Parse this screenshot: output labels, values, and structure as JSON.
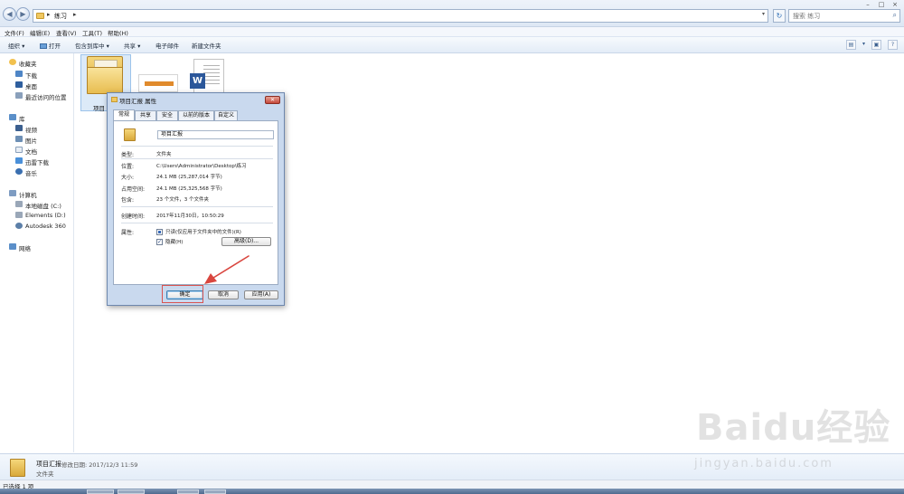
{
  "address": {
    "path": "练习",
    "search_placeholder": "搜索 练习"
  },
  "menu": [
    "文件(F)",
    "编辑(E)",
    "查看(V)",
    "工具(T)",
    "帮助(H)"
  ],
  "toolbar": {
    "organize": "组织 ▾",
    "open": "打开",
    "include": "包含到库中 ▾",
    "share": "共享 ▾",
    "email": "电子邮件",
    "new_folder": "新建文件夹"
  },
  "nav": {
    "favorites": "收藏夹",
    "downloads": "下载",
    "desktop": "桌面",
    "recent": "最近访问的位置",
    "libraries": "库",
    "videos": "视频",
    "pictures": "图片",
    "documents": "文档",
    "thunder": "迅雷下载",
    "music": "音乐",
    "computer": "计算机",
    "local_disk": "本地磁盘 (C:)",
    "elements": "Elements (D:)",
    "autodesk": "Autodesk 360",
    "network": "网络"
  },
  "files": {
    "folder_label": "项目"
  },
  "dialog": {
    "title": "项目汇报 属性",
    "tabs": [
      "常规",
      "共享",
      "安全",
      "以前的版本",
      "自定义"
    ],
    "name": "项目汇报",
    "type_label": "类型:",
    "type_value": "文件夹",
    "location_label": "位置:",
    "location_value": "C:\\Users\\Administrator\\Desktop\\练习",
    "size_label": "大小:",
    "size_value": "24.1 MB (25,287,014 字节)",
    "disk_label": "占用空间:",
    "disk_value": "24.1 MB (25,325,568 字节)",
    "contains_label": "包含:",
    "contains_value": "23 个文件，3 个文件夹",
    "created_label": "创建时间:",
    "created_value": "2017年11月30日，10:50:29",
    "attr_label": "属性:",
    "readonly_label": "只读(仅应用于文件夹中的文件)(R)",
    "hidden_label": "隐藏(H)",
    "advanced_button": "高级(D)...",
    "ok_button": "确定",
    "cancel_button": "取消",
    "apply_button": "应用(A)"
  },
  "details": {
    "name": "项目汇报",
    "modified": "修改日期: 2017/12/3 11:59",
    "type": "文件夹"
  },
  "status": "已选择 1 项",
  "watermark": {
    "brand": "Baidu经验",
    "url": "jingyan.baidu.com"
  },
  "colors": {
    "accent": "#3c7fb1",
    "arrow": "#d9463f"
  }
}
